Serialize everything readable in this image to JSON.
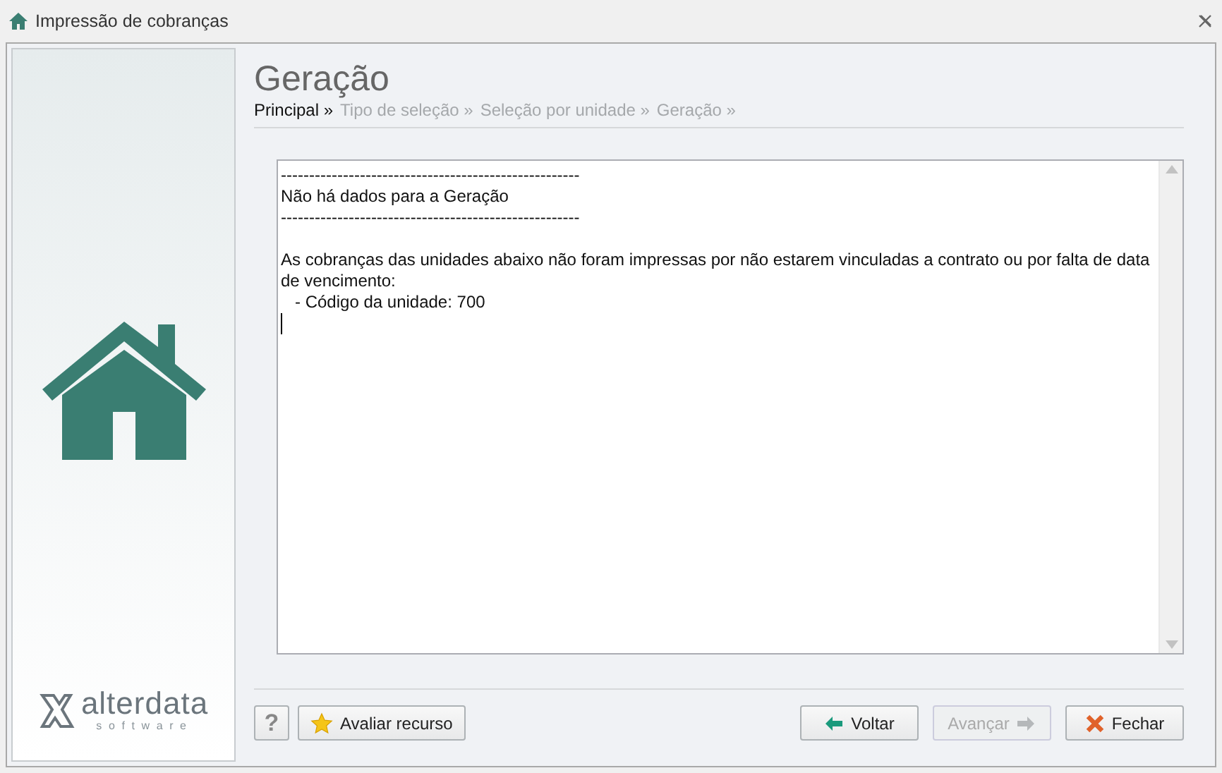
{
  "window": {
    "title": "Impressão de cobranças"
  },
  "sidebar": {
    "logo_name": "alterdata",
    "logo_tagline": "software"
  },
  "header": {
    "title": "Geração"
  },
  "breadcrumb": [
    {
      "label": "Principal »",
      "selected": true
    },
    {
      "label": "Tipo de seleção »",
      "selected": false
    },
    {
      "label": "Seleção por unidade »",
      "selected": false
    },
    {
      "label": "Geração »",
      "selected": false
    }
  ],
  "output": {
    "banner": [
      "-----------------------------------------------------",
      "Não há dados para a Geração",
      "-----------------------------------------------------"
    ],
    "message": [
      "As cobranças das unidades abaixo não foram impressas por não estarem vinculadas a contrato ou por falta de data de vencimento:",
      "   - Código da unidade: 700"
    ]
  },
  "footer": {
    "help": "?",
    "rate": "Avaliar recurso",
    "buttons": [
      {
        "kind": "back",
        "label": "Voltar",
        "disabled": false
      },
      {
        "kind": "next",
        "label": "Avançar",
        "disabled": true
      },
      {
        "kind": "close",
        "label": "Fechar",
        "disabled": false
      }
    ]
  }
}
